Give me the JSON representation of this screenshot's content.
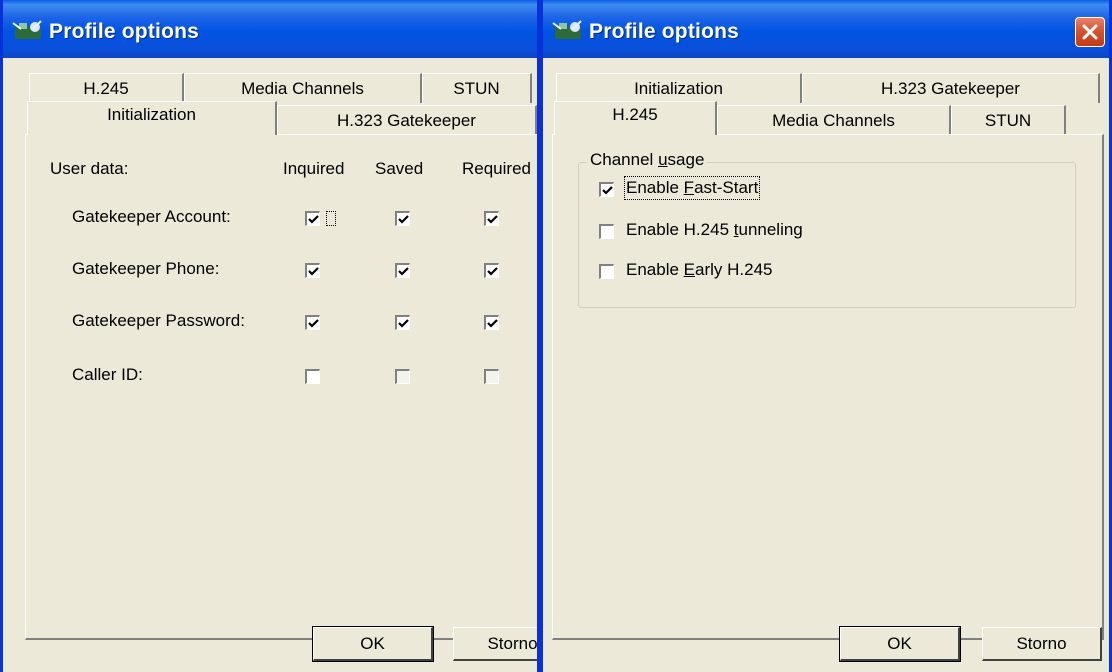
{
  "left": {
    "title": "Profile options",
    "tabs_back": [
      "H.245",
      "Media Channels",
      "STUN"
    ],
    "tabs_front": [
      "Initialization",
      "H.323 Gatekeeper"
    ],
    "header": {
      "user_data": "User data:",
      "inquired": "Inquired",
      "saved": "Saved",
      "required": "Required"
    },
    "rows": [
      {
        "label": "Gatekeeper Account:",
        "inquired": true,
        "saved": true,
        "required": true
      },
      {
        "label": "Gatekeeper Phone:",
        "inquired": true,
        "saved": true,
        "required": true
      },
      {
        "label": "Gatekeeper Password:",
        "inquired": true,
        "saved": true,
        "required": true
      },
      {
        "label": "Caller ID:",
        "inquired": false,
        "saved": false,
        "required": false
      }
    ],
    "buttons": {
      "ok": "OK",
      "storno": "Storno"
    }
  },
  "right": {
    "title": "Profile options",
    "tabs_back": [
      "Initialization",
      "H.323 Gatekeeper"
    ],
    "tabs_front": [
      "H.245",
      "Media Channels",
      "STUN"
    ],
    "group": {
      "pre": "Channel ",
      "u": "u",
      "post": "sage"
    },
    "options": [
      {
        "pre": "Enable ",
        "u": "F",
        "post": "ast-Start",
        "checked": true
      },
      {
        "pre": "Enable H.245 ",
        "u": "t",
        "post": "unneling",
        "checked": false
      },
      {
        "pre": "Enable ",
        "u": "E",
        "post": "arly H.245",
        "checked": false
      }
    ],
    "buttons": {
      "ok": "OK",
      "storno": "Storno"
    }
  },
  "icons": {
    "title": "network-phone-icon",
    "close": "close-icon",
    "check": "checkmark-icon"
  },
  "colors": {
    "titlebar": "#0054e3",
    "face": "#ece9d8",
    "close": "#d9532f",
    "border": "#0831d9"
  }
}
